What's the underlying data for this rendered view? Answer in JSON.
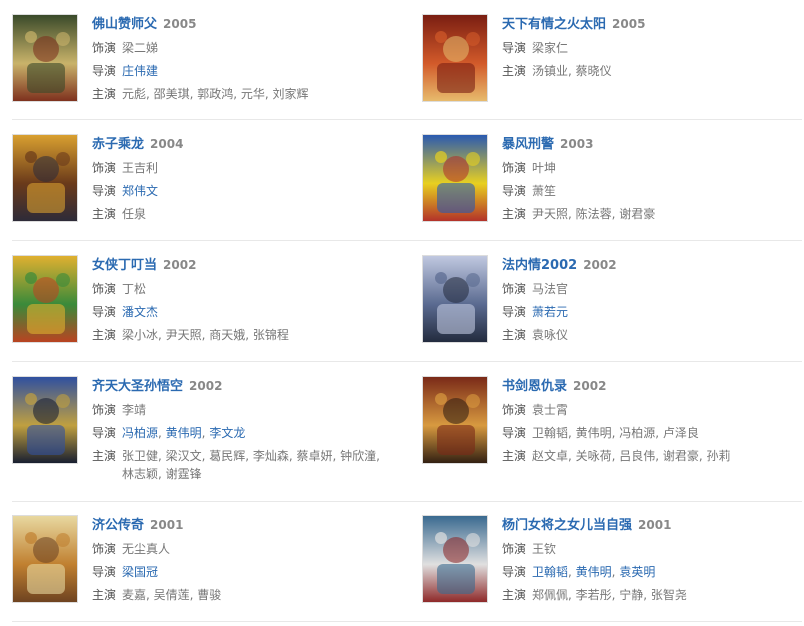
{
  "items": [
    {
      "title": "佛山赞师父",
      "year": "2005",
      "role_label": "饰演",
      "role": "梁二娣",
      "director_label": "导演",
      "directors": [
        {
          "name": "庄伟建",
          "link": true
        }
      ],
      "cast_label": "主演",
      "cast": "元彪, 邵美琪, 郭政鸿, 元华, 刘家辉",
      "poster_colors": [
        "#3a4a2a",
        "#c9b36a",
        "#7a2a1a"
      ]
    },
    {
      "title": "天下有情之火太阳",
      "year": "2005",
      "role_label": "导演",
      "role": "梁家仁",
      "director_label": "主演",
      "directors": [
        {
          "name": "汤镇业, 蔡晓仪",
          "link": false
        }
      ],
      "cast_label": "",
      "cast": "",
      "poster_colors": [
        "#7a1e12",
        "#d25a2a",
        "#e8c070"
      ]
    },
    {
      "title": "赤子乘龙",
      "year": "2004",
      "role_label": "饰演",
      "role": "王吉利",
      "director_label": "导演",
      "directors": [
        {
          "name": "郑伟文",
          "link": true
        }
      ],
      "cast_label": "主演",
      "cast": "任泉",
      "poster_colors": [
        "#d9a030",
        "#6a3a1a",
        "#2a2a3a"
      ]
    },
    {
      "title": "暴风刑警",
      "year": "2003",
      "role_label": "饰演",
      "role": "叶坤",
      "director_label": "导演",
      "directors": [
        {
          "name": "萧笙",
          "link": false
        }
      ],
      "cast_label": "主演",
      "cast": "尹天照, 陈法蓉, 谢君豪",
      "poster_colors": [
        "#2a5ab0",
        "#e8d020",
        "#b02a2a"
      ]
    },
    {
      "title": "女侠丁叮当",
      "year": "2002",
      "role_label": "饰演",
      "role": "丁松",
      "director_label": "导演",
      "directors": [
        {
          "name": "潘文杰",
          "link": true
        }
      ],
      "cast_label": "主演",
      "cast": "梁小冰, 尹天照, 商天娥, 张锦程",
      "poster_colors": [
        "#e0b030",
        "#3a8a3a",
        "#c04020"
      ]
    },
    {
      "title": "法内情2002",
      "year": "2002",
      "role_label": "饰演",
      "role": "马法官",
      "director_label": "导演",
      "directors": [
        {
          "name": "萧若元",
          "link": true
        }
      ],
      "cast_label": "主演",
      "cast": "袁咏仪",
      "poster_colors": [
        "#c0c8e0",
        "#5a6a90",
        "#20283a"
      ]
    },
    {
      "title": "齐天大圣孙悟空",
      "year": "2002",
      "role_label": "饰演",
      "role": "李靖",
      "director_label": "导演",
      "directors": [
        {
          "name": "冯柏源",
          "link": true
        },
        {
          "name": "黄伟明",
          "link": true
        },
        {
          "name": "李文龙",
          "link": true
        }
      ],
      "cast_label": "主演",
      "cast": "张卫健, 梁汉文, 葛民辉, 李灿森, 蔡卓妍, 钟欣潼, 林志颖, 谢霆锋",
      "poster_colors": [
        "#3050a0",
        "#c0a040",
        "#101830"
      ]
    },
    {
      "title": "书剑恩仇录",
      "year": "2002",
      "role_label": "饰演",
      "role": "袁士霄",
      "director_label": "导演",
      "directors": [
        {
          "name": "卫翰韬, 黄伟明, 冯柏源, 卢泽良",
          "link": false
        }
      ],
      "cast_label": "主演",
      "cast": "赵文卓, 关咏荷, 吕良伟, 谢君豪, 孙莉",
      "poster_colors": [
        "#7a2a18",
        "#d89a40",
        "#2a1a10"
      ]
    },
    {
      "title": "济公传奇",
      "year": "2001",
      "role_label": "饰演",
      "role": "无尘真人",
      "director_label": "导演",
      "directors": [
        {
          "name": "梁国冠",
          "link": true
        }
      ],
      "cast_label": "主演",
      "cast": "麦嘉, 吴倩莲, 曹骏",
      "poster_colors": [
        "#e8d8a0",
        "#c08030",
        "#6a4020"
      ]
    },
    {
      "title": "杨门女将之女儿当自强",
      "year": "2001",
      "role_label": "饰演",
      "role": "王钦",
      "director_label": "导演",
      "directors": [
        {
          "name": "卫翰韬",
          "link": true
        },
        {
          "name": "黄伟明",
          "link": true
        },
        {
          "name": "袁英明",
          "link": true
        }
      ],
      "cast_label": "主演",
      "cast": "郑佩佩, 李若彤, 宁静, 张智尧",
      "poster_colors": [
        "#3a6a90",
        "#e0e0e0",
        "#8a2020"
      ]
    }
  ]
}
